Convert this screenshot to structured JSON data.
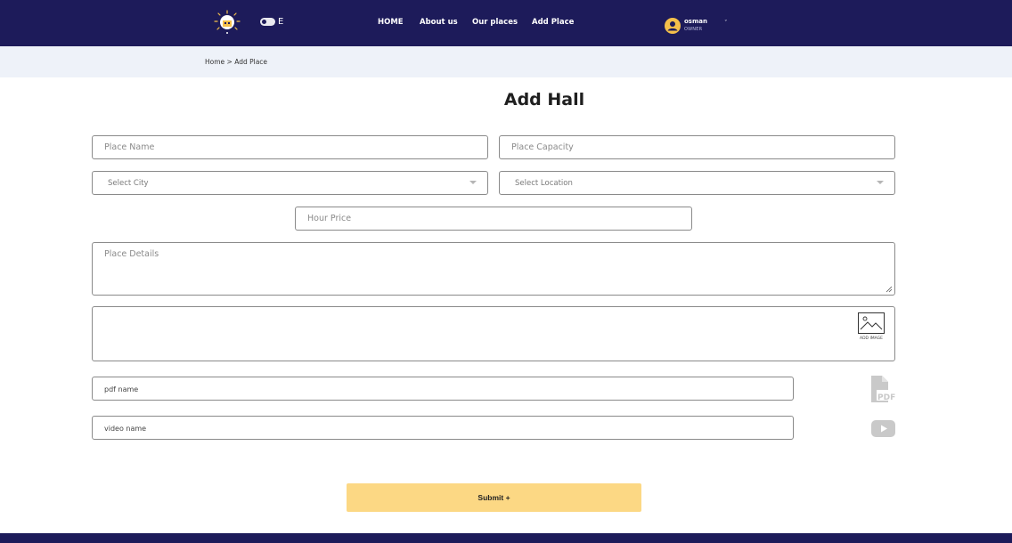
{
  "header": {
    "lang_label": "E",
    "nav": [
      {
        "label": "HOME"
      },
      {
        "label": "About us"
      },
      {
        "label": "Our places"
      },
      {
        "label": "Add Place"
      }
    ],
    "user": {
      "name": "osman",
      "role": "OWNER",
      "caret": "ˇ"
    }
  },
  "breadcrumb": {
    "text": "Home > Add Place"
  },
  "form": {
    "title": "Add Hall",
    "place_name_placeholder": "Place Name",
    "place_capacity_placeholder": "Place Capacity",
    "city_select_value": "Select City",
    "location_select_value": "Select Location",
    "hour_price_placeholder": "Hour Price",
    "place_details_placeholder": "Place Details",
    "add_image_label": "ADD IMAGE",
    "pdf_name_value": "pdf name",
    "video_name_value": "video name",
    "pdf_icon_label": "PDF",
    "submit_label": "Submit +"
  },
  "icons": [
    "logo-icon",
    "theme-toggle-icon",
    "user-avatar-icon",
    "chevron-down-icon",
    "add-image-icon",
    "pdf-icon",
    "youtube-icon"
  ],
  "colors": {
    "nav_bg": "#1d1b5a",
    "breadcrumb_bg": "#eef2f9",
    "submit_bg": "#fcd884",
    "avatar": "#f5c04a",
    "icon_gray": "#c9c9c9"
  }
}
